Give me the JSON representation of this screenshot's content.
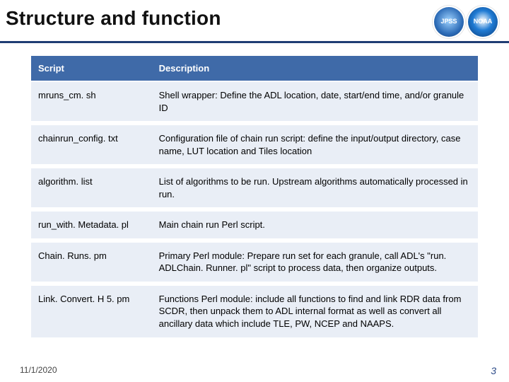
{
  "header": {
    "title": "Structure and function",
    "logos": [
      {
        "name": "jpss-logo",
        "label": "JPSS"
      },
      {
        "name": "noaa-logo",
        "label": "NOAA"
      }
    ]
  },
  "table": {
    "headers": {
      "col1": "Script",
      "col2": "Description"
    },
    "rows": [
      {
        "name": "mruns_cm. sh",
        "desc": "Shell wrapper: Define the ADL location, date, start/end time, and/or granule ID"
      },
      {
        "name": "chainrun_config. txt",
        "desc": "Configuration file of chain run script: define the input/output directory, case name, LUT location and Tiles location"
      },
      {
        "name": "algorithm. list",
        "desc": "List of algorithms to be run. Upstream algorithms automatically processed in run."
      },
      {
        "name": "run_with. Metadata. pl",
        "desc": "Main chain run Perl script."
      },
      {
        "name": "Chain. Runs. pm",
        "desc": "Primary Perl module: Prepare run set for each granule, call ADL's \"run. ADLChain. Runner. pl\" script to process data, then organize outputs."
      },
      {
        "name": "Link. Convert. H 5. pm",
        "desc": "Functions Perl module: include all functions to find and link RDR data from SCDR, then unpack them to ADL internal format as well as convert all ancillary data which include TLE, PW, NCEP and NAAPS."
      }
    ]
  },
  "footer": {
    "date": "11/1/2020",
    "page": "3"
  }
}
